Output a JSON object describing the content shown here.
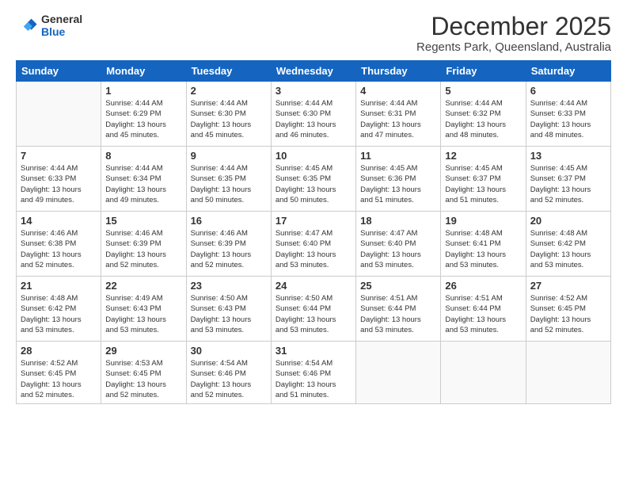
{
  "logo": {
    "general": "General",
    "blue": "Blue"
  },
  "header": {
    "month": "December 2025",
    "location": "Regents Park, Queensland, Australia"
  },
  "weekdays": [
    "Sunday",
    "Monday",
    "Tuesday",
    "Wednesday",
    "Thursday",
    "Friday",
    "Saturday"
  ],
  "weeks": [
    [
      {
        "day": "",
        "info": ""
      },
      {
        "day": "1",
        "info": "Sunrise: 4:44 AM\nSunset: 6:29 PM\nDaylight: 13 hours\nand 45 minutes."
      },
      {
        "day": "2",
        "info": "Sunrise: 4:44 AM\nSunset: 6:30 PM\nDaylight: 13 hours\nand 45 minutes."
      },
      {
        "day": "3",
        "info": "Sunrise: 4:44 AM\nSunset: 6:30 PM\nDaylight: 13 hours\nand 46 minutes."
      },
      {
        "day": "4",
        "info": "Sunrise: 4:44 AM\nSunset: 6:31 PM\nDaylight: 13 hours\nand 47 minutes."
      },
      {
        "day": "5",
        "info": "Sunrise: 4:44 AM\nSunset: 6:32 PM\nDaylight: 13 hours\nand 48 minutes."
      },
      {
        "day": "6",
        "info": "Sunrise: 4:44 AM\nSunset: 6:33 PM\nDaylight: 13 hours\nand 48 minutes."
      }
    ],
    [
      {
        "day": "7",
        "info": "Sunrise: 4:44 AM\nSunset: 6:33 PM\nDaylight: 13 hours\nand 49 minutes."
      },
      {
        "day": "8",
        "info": "Sunrise: 4:44 AM\nSunset: 6:34 PM\nDaylight: 13 hours\nand 49 minutes."
      },
      {
        "day": "9",
        "info": "Sunrise: 4:44 AM\nSunset: 6:35 PM\nDaylight: 13 hours\nand 50 minutes."
      },
      {
        "day": "10",
        "info": "Sunrise: 4:45 AM\nSunset: 6:35 PM\nDaylight: 13 hours\nand 50 minutes."
      },
      {
        "day": "11",
        "info": "Sunrise: 4:45 AM\nSunset: 6:36 PM\nDaylight: 13 hours\nand 51 minutes."
      },
      {
        "day": "12",
        "info": "Sunrise: 4:45 AM\nSunset: 6:37 PM\nDaylight: 13 hours\nand 51 minutes."
      },
      {
        "day": "13",
        "info": "Sunrise: 4:45 AM\nSunset: 6:37 PM\nDaylight: 13 hours\nand 52 minutes."
      }
    ],
    [
      {
        "day": "14",
        "info": "Sunrise: 4:46 AM\nSunset: 6:38 PM\nDaylight: 13 hours\nand 52 minutes."
      },
      {
        "day": "15",
        "info": "Sunrise: 4:46 AM\nSunset: 6:39 PM\nDaylight: 13 hours\nand 52 minutes."
      },
      {
        "day": "16",
        "info": "Sunrise: 4:46 AM\nSunset: 6:39 PM\nDaylight: 13 hours\nand 52 minutes."
      },
      {
        "day": "17",
        "info": "Sunrise: 4:47 AM\nSunset: 6:40 PM\nDaylight: 13 hours\nand 53 minutes."
      },
      {
        "day": "18",
        "info": "Sunrise: 4:47 AM\nSunset: 6:40 PM\nDaylight: 13 hours\nand 53 minutes."
      },
      {
        "day": "19",
        "info": "Sunrise: 4:48 AM\nSunset: 6:41 PM\nDaylight: 13 hours\nand 53 minutes."
      },
      {
        "day": "20",
        "info": "Sunrise: 4:48 AM\nSunset: 6:42 PM\nDaylight: 13 hours\nand 53 minutes."
      }
    ],
    [
      {
        "day": "21",
        "info": "Sunrise: 4:48 AM\nSunset: 6:42 PM\nDaylight: 13 hours\nand 53 minutes."
      },
      {
        "day": "22",
        "info": "Sunrise: 4:49 AM\nSunset: 6:43 PM\nDaylight: 13 hours\nand 53 minutes."
      },
      {
        "day": "23",
        "info": "Sunrise: 4:50 AM\nSunset: 6:43 PM\nDaylight: 13 hours\nand 53 minutes."
      },
      {
        "day": "24",
        "info": "Sunrise: 4:50 AM\nSunset: 6:44 PM\nDaylight: 13 hours\nand 53 minutes."
      },
      {
        "day": "25",
        "info": "Sunrise: 4:51 AM\nSunset: 6:44 PM\nDaylight: 13 hours\nand 53 minutes."
      },
      {
        "day": "26",
        "info": "Sunrise: 4:51 AM\nSunset: 6:44 PM\nDaylight: 13 hours\nand 53 minutes."
      },
      {
        "day": "27",
        "info": "Sunrise: 4:52 AM\nSunset: 6:45 PM\nDaylight: 13 hours\nand 52 minutes."
      }
    ],
    [
      {
        "day": "28",
        "info": "Sunrise: 4:52 AM\nSunset: 6:45 PM\nDaylight: 13 hours\nand 52 minutes."
      },
      {
        "day": "29",
        "info": "Sunrise: 4:53 AM\nSunset: 6:45 PM\nDaylight: 13 hours\nand 52 minutes."
      },
      {
        "day": "30",
        "info": "Sunrise: 4:54 AM\nSunset: 6:46 PM\nDaylight: 13 hours\nand 52 minutes."
      },
      {
        "day": "31",
        "info": "Sunrise: 4:54 AM\nSunset: 6:46 PM\nDaylight: 13 hours\nand 51 minutes."
      },
      {
        "day": "",
        "info": ""
      },
      {
        "day": "",
        "info": ""
      },
      {
        "day": "",
        "info": ""
      }
    ]
  ]
}
